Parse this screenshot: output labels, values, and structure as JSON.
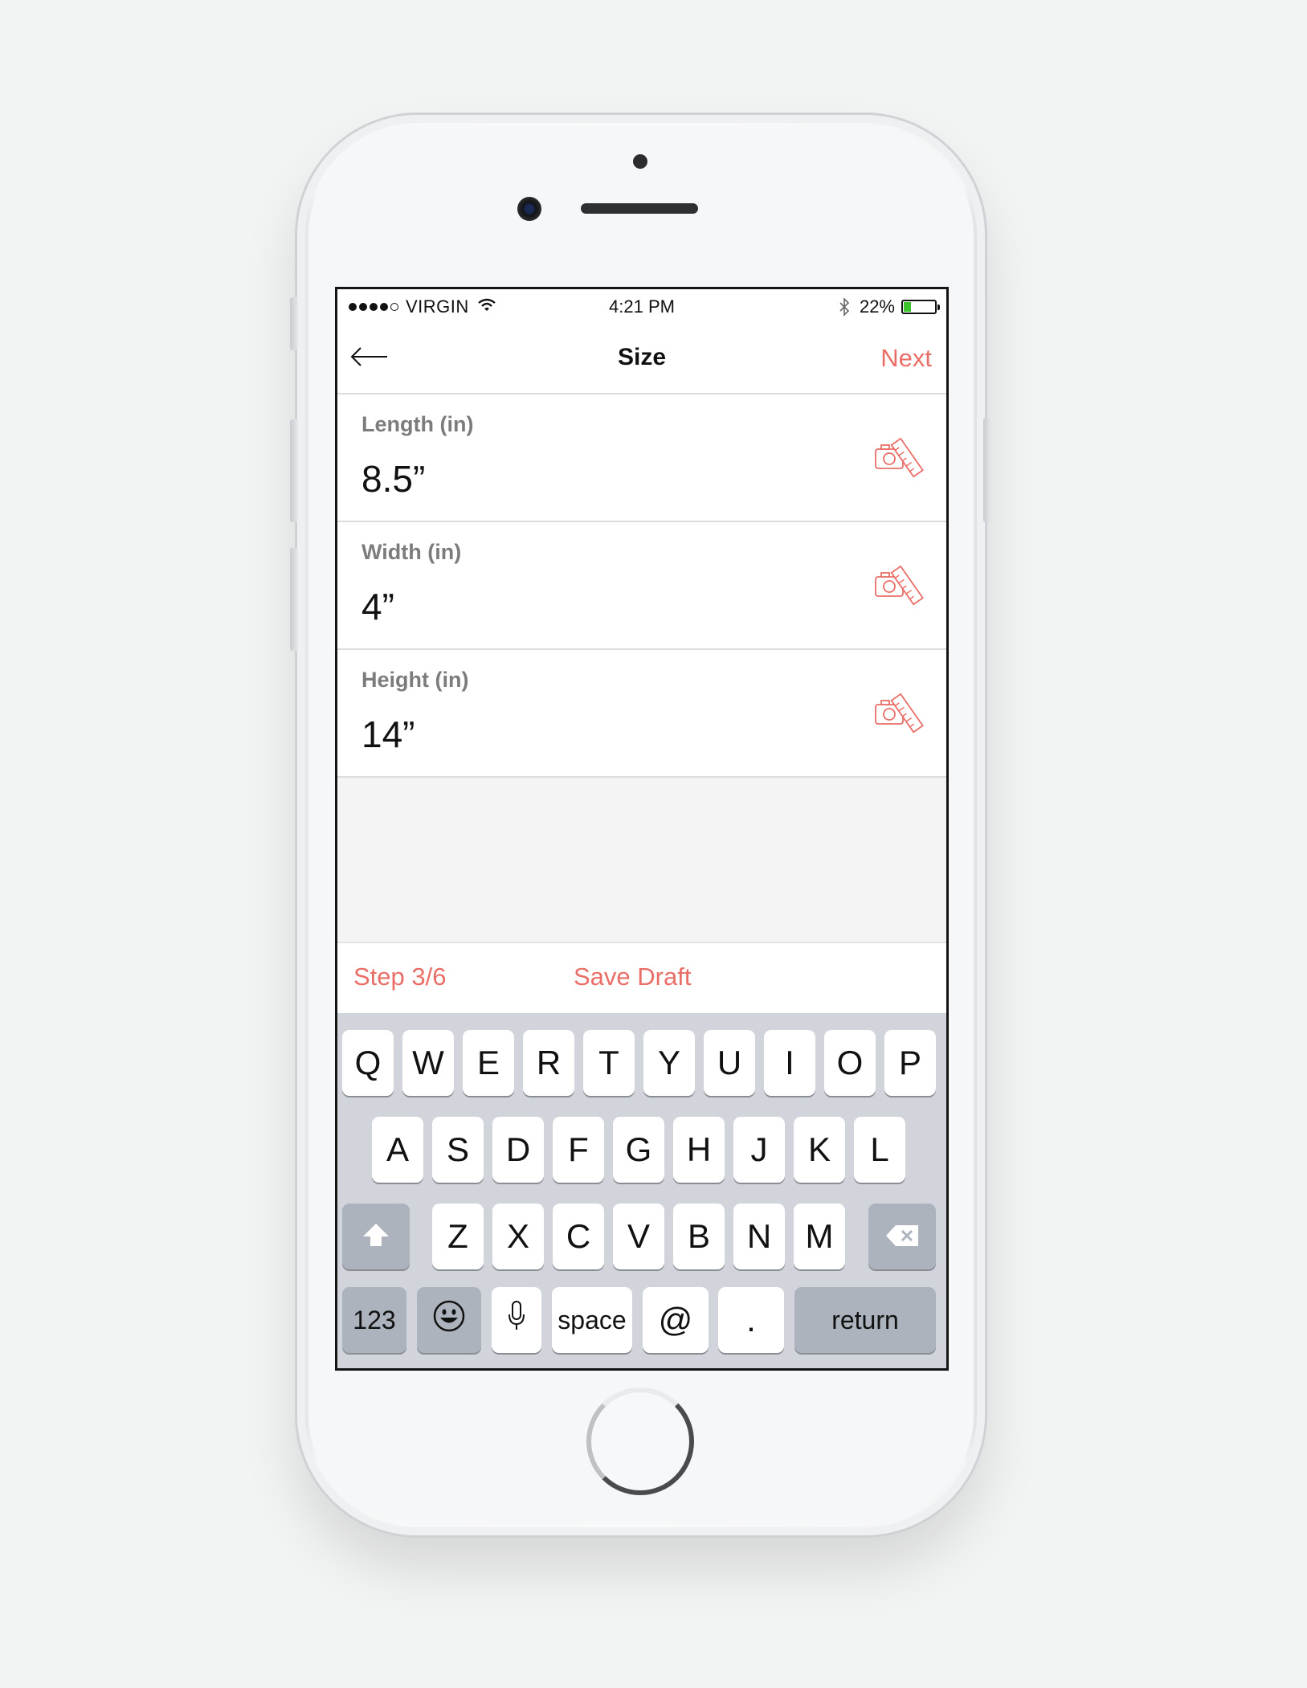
{
  "status_bar": {
    "carrier": "VIRGIN",
    "time": "4:21 PM",
    "battery_percent": "22%",
    "battery_level": 0.22,
    "signal_bars": 4,
    "icons": [
      "wifi-icon",
      "bluetooth-icon",
      "battery-icon"
    ]
  },
  "nav": {
    "title": "Size",
    "next_label": "Next",
    "back_icon": "arrow-left-icon"
  },
  "fields": [
    {
      "label": "Length (in)",
      "value": "8.5”",
      "icon": "camera-ruler-icon"
    },
    {
      "label": "Width (in)",
      "value": "4”",
      "icon": "camera-ruler-icon"
    },
    {
      "label": "Height (in)",
      "value": "14”",
      "icon": "camera-ruler-icon"
    }
  ],
  "footer": {
    "step_label": "Step 3/6",
    "save_draft_label": "Save Draft"
  },
  "keyboard": {
    "row1": [
      "Q",
      "W",
      "E",
      "R",
      "T",
      "Y",
      "U",
      "I",
      "O",
      "P"
    ],
    "row2": [
      "A",
      "S",
      "D",
      "F",
      "G",
      "H",
      "J",
      "K",
      "L"
    ],
    "row3": [
      "Z",
      "X",
      "C",
      "V",
      "B",
      "N",
      "M"
    ],
    "numbers_label": "123",
    "space_label": "space",
    "at_label": "@",
    "period_label": ".",
    "return_label": "return",
    "icons": [
      "shift-icon",
      "delete-icon",
      "emoji-icon",
      "microphone-icon"
    ]
  },
  "colors": {
    "accent": "#ea6e67",
    "keyboard_bg": "#d1d5db",
    "battery_fill": "#3cc42b"
  }
}
